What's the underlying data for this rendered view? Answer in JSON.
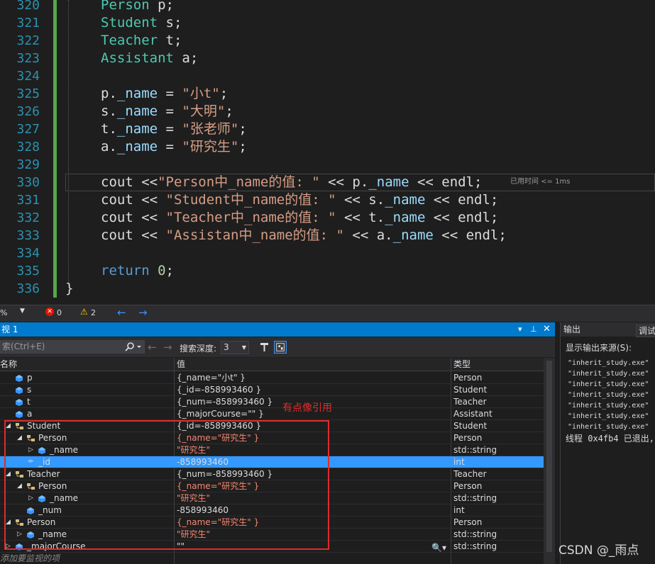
{
  "editor": {
    "lines": [
      {
        "n": "320",
        "tokens": [
          [
            "type",
            "Person"
          ],
          [
            "plain",
            " "
          ],
          [
            "plain",
            "p;"
          ]
        ]
      },
      {
        "n": "321",
        "tokens": [
          [
            "type",
            "Student"
          ],
          [
            "plain",
            " s;"
          ]
        ]
      },
      {
        "n": "322",
        "tokens": [
          [
            "type",
            "Teacher"
          ],
          [
            "plain",
            " t;"
          ]
        ]
      },
      {
        "n": "323",
        "tokens": [
          [
            "type",
            "Assistant"
          ],
          [
            "plain",
            " a;"
          ]
        ]
      },
      {
        "n": "324",
        "tokens": []
      },
      {
        "n": "325",
        "tokens": [
          [
            "plain",
            "p."
          ],
          [
            "var",
            "_name"
          ],
          [
            "plain",
            " = "
          ],
          [
            "str",
            "\"小t\""
          ],
          [
            "plain",
            ";"
          ]
        ]
      },
      {
        "n": "326",
        "tokens": [
          [
            "plain",
            "s."
          ],
          [
            "var",
            "_name"
          ],
          [
            "plain",
            " = "
          ],
          [
            "str",
            "\"大明\""
          ],
          [
            "plain",
            ";"
          ]
        ]
      },
      {
        "n": "327",
        "tokens": [
          [
            "plain",
            "t."
          ],
          [
            "var",
            "_name"
          ],
          [
            "plain",
            " = "
          ],
          [
            "str",
            "\"张老师\""
          ],
          [
            "plain",
            ";"
          ]
        ]
      },
      {
        "n": "328",
        "tokens": [
          [
            "plain",
            "a."
          ],
          [
            "var",
            "_name"
          ],
          [
            "plain",
            " = "
          ],
          [
            "str",
            "\"研究生\""
          ],
          [
            "plain",
            ";"
          ]
        ]
      },
      {
        "n": "329",
        "tokens": []
      },
      {
        "n": "330",
        "tokens": [
          [
            "plain",
            "cout <<"
          ],
          [
            "str",
            "\"Person中_name的值: \""
          ],
          [
            "plain",
            " << p."
          ],
          [
            "var",
            "_name"
          ],
          [
            "plain",
            " << endl;"
          ]
        ]
      },
      {
        "n": "331",
        "tokens": [
          [
            "plain",
            "cout << "
          ],
          [
            "str",
            "\"Student中_name的值: \""
          ],
          [
            "plain",
            " << s."
          ],
          [
            "var",
            "_name"
          ],
          [
            "plain",
            " << endl;"
          ]
        ]
      },
      {
        "n": "332",
        "tokens": [
          [
            "plain",
            "cout << "
          ],
          [
            "str",
            "\"Teacher中_name的值: \""
          ],
          [
            "plain",
            " << t."
          ],
          [
            "var",
            "_name"
          ],
          [
            "plain",
            " << endl;"
          ]
        ]
      },
      {
        "n": "333",
        "tokens": [
          [
            "plain",
            "cout << "
          ],
          [
            "str",
            "\"Assistan中_name的值: \""
          ],
          [
            "plain",
            " << a."
          ],
          [
            "var",
            "_name"
          ],
          [
            "plain",
            " << endl;"
          ]
        ]
      },
      {
        "n": "334",
        "tokens": []
      },
      {
        "n": "335",
        "tokens": [
          [
            "kw",
            "return"
          ],
          [
            "plain",
            " "
          ],
          [
            "num",
            "0"
          ],
          [
            "plain",
            ";"
          ]
        ]
      },
      {
        "n": "336",
        "tokens": []
      }
    ],
    "closing_brace": "}",
    "perf_tip": "已用时间 <= 1ms"
  },
  "status": {
    "zoom": "%",
    "errors": "0",
    "warnings": "2"
  },
  "watch": {
    "title": "视 1",
    "search_placeholder": "索(Ctrl+E)",
    "depth_label": "搜索深度:",
    "depth_value": "3",
    "col_name": "名称",
    "col_value": "值",
    "col_type": "类型",
    "rows": [
      {
        "indent": 0,
        "exp": "",
        "icon": "field",
        "name": "p",
        "value": "{_name=\"小t\" }",
        "type": "Person",
        "changed": false
      },
      {
        "indent": 0,
        "exp": "",
        "icon": "field",
        "name": "s",
        "value": "{_id=-858993460 }",
        "type": "Student",
        "changed": false
      },
      {
        "indent": 0,
        "exp": "",
        "icon": "field",
        "name": "t",
        "value": "{_num=-858993460 }",
        "type": "Teacher",
        "changed": false
      },
      {
        "indent": 0,
        "exp": "",
        "icon": "field",
        "name": "a",
        "value": "{_majorCourse=\"\" }",
        "type": "Assistant",
        "changed": false
      },
      {
        "indent": 0,
        "exp": "open",
        "icon": "base",
        "name": "Student",
        "value": "{_id=-858993460 }",
        "type": "Student",
        "changed": false
      },
      {
        "indent": 1,
        "exp": "open",
        "icon": "base",
        "name": "Person",
        "value": "{_name=\"研究生\" }",
        "type": "Person",
        "changed": true
      },
      {
        "indent": 2,
        "exp": "closed",
        "icon": "field",
        "name": "_name",
        "value": "\"研究生\"",
        "type": "std::string",
        "changed": true
      },
      {
        "indent": 1,
        "exp": "",
        "icon": "field",
        "name": "_id",
        "value": "-858993460",
        "type": "int",
        "changed": false,
        "selected": true
      },
      {
        "indent": 0,
        "exp": "open",
        "icon": "base",
        "name": "Teacher",
        "value": "{_num=-858993460 }",
        "type": "Teacher",
        "changed": false
      },
      {
        "indent": 1,
        "exp": "open",
        "icon": "base",
        "name": "Person",
        "value": "{_name=\"研究生\" }",
        "type": "Person",
        "changed": true
      },
      {
        "indent": 2,
        "exp": "closed",
        "icon": "field",
        "name": "_name",
        "value": "\"研究生\"",
        "type": "std::string",
        "changed": true
      },
      {
        "indent": 1,
        "exp": "",
        "icon": "field",
        "name": "_num",
        "value": "-858993460",
        "type": "int",
        "changed": false
      },
      {
        "indent": 0,
        "exp": "open",
        "icon": "base",
        "name": "Person",
        "value": "{_name=\"研究生\" }",
        "type": "Person",
        "changed": true
      },
      {
        "indent": 1,
        "exp": "closed",
        "icon": "field",
        "name": "_name",
        "value": "\"研究生\"",
        "type": "std::string",
        "changed": true
      },
      {
        "indent": 0,
        "exp": "closed",
        "icon": "field",
        "name": "_majorCourse",
        "value": "\"\"",
        "type": "std::string",
        "changed": false
      }
    ],
    "add_item_placeholder": "添加要监视的项",
    "annotation": "有点像引用"
  },
  "output": {
    "title": "输出",
    "source_label": "显示输出来源(S):",
    "source_value": "调试",
    "lines": [
      "\"inherit_study.exe\"",
      "\"inherit_study.exe\"",
      "\"inherit_study.exe\"",
      "\"inherit_study.exe\"",
      "\"inherit_study.exe\"",
      "\"inherit_study.exe\"",
      "\"inherit_study.exe\""
    ],
    "last_line": "线程 0x4fb4 已退出,"
  },
  "watermark": "CSDN @_雨点",
  "colors": {
    "accent": "#007acc",
    "selection": "#3399ff",
    "changed_value": "#f48771",
    "annotation": "#e02b2b",
    "type_token": "#4ec9b0",
    "string_token": "#d69d85"
  }
}
